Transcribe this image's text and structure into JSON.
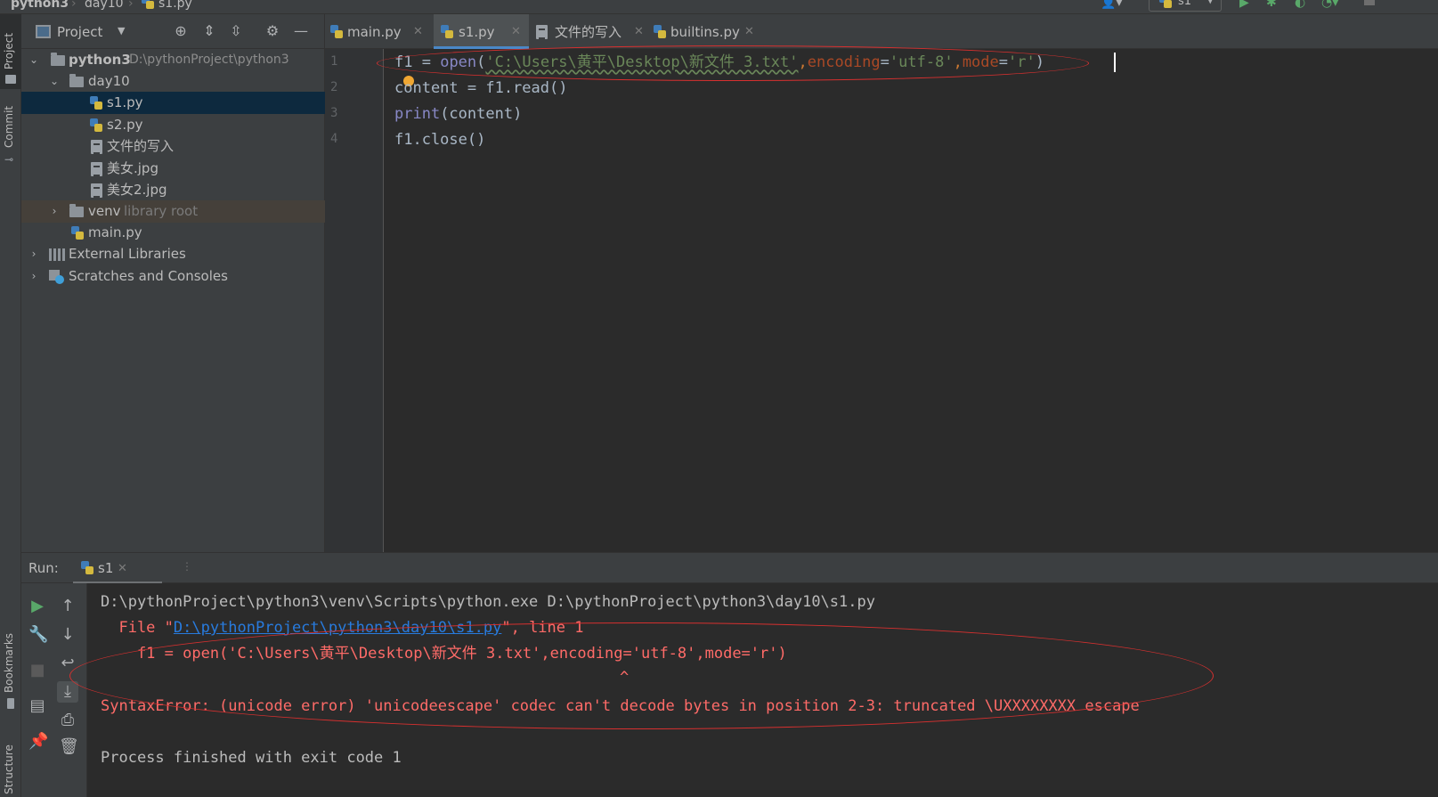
{
  "navbar": {
    "crumbs": [
      "python3",
      "day10",
      "s1.py"
    ],
    "run_config": "s1"
  },
  "left_stripe": {
    "project": "Project",
    "commit": "Commit",
    "bookmarks": "Bookmarks",
    "structure": "Structure"
  },
  "project_panel": {
    "title": "Project",
    "tree": [
      {
        "label": "python3",
        "path": "D:\\pythonProject\\python3"
      },
      {
        "label": "day10"
      },
      {
        "label": "s1.py"
      },
      {
        "label": "s2.py"
      },
      {
        "label": "文件的写入"
      },
      {
        "label": "美女.jpg"
      },
      {
        "label": "美女2.jpg"
      },
      {
        "label": "venv",
        "hint": "library root"
      },
      {
        "label": "main.py"
      },
      {
        "label": "External Libraries"
      },
      {
        "label": "Scratches and Consoles"
      }
    ]
  },
  "tabs": [
    {
      "label": "main.py"
    },
    {
      "label": "s1.py"
    },
    {
      "label": "文件的写入"
    },
    {
      "label": "builtins.py"
    }
  ],
  "editor": {
    "line_numbers": [
      "1",
      "2",
      "3",
      "4"
    ],
    "line1": {
      "var": "f1",
      "eq": " = ",
      "func": "open",
      "lparen": "(",
      "path": "'C:\\Users\\黄平\\Desktop\\新文件 3.txt'",
      "comma1": ",",
      "enc_kw": "encoding",
      "enc_eq": "=",
      "enc_val": "'utf-8'",
      "comma2": ",",
      "mode_kw": "mode",
      "mode_eq": "=",
      "mode_val": "'r'",
      "rparen": ")"
    },
    "line2": "content = f1.read()",
    "line3": {
      "func": "print",
      "rest": "(content)"
    },
    "line4": "f1.close()"
  },
  "run": {
    "label": "Run:",
    "tab": "s1",
    "console": {
      "cmd": "D:\\pythonProject\\python3\\venv\\Scripts\\python.exe D:\\pythonProject\\python3\\day10\\s1.py",
      "file_prefix": "  File \"",
      "file_link": "D:\\pythonProject\\python3\\day10\\s1.py",
      "file_suffix": "\", line 1",
      "code_line": "    f1 = open('C:\\Users\\黄平\\Desktop\\新文件 3.txt',encoding='utf-8',mode='r')",
      "caret": "^",
      "error": "SyntaxError: (unicode error) 'unicodeescape' codec can't decode bytes in position 2-3: truncated \\UXXXXXXXX escape",
      "finished": "Process finished with exit code 1"
    }
  }
}
